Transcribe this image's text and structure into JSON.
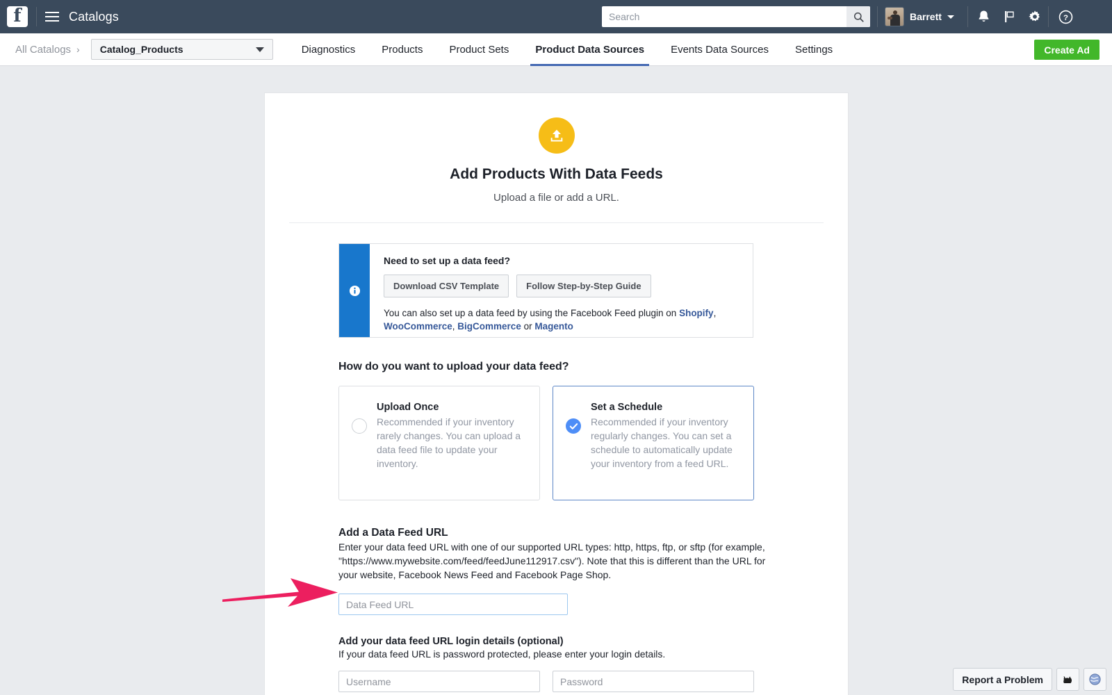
{
  "topbar": {
    "logo": "facebook-logo",
    "app_title": "Catalogs",
    "search": {
      "placeholder": "Search",
      "value": "",
      "icon": "search-icon"
    },
    "user": {
      "name": "Barrett",
      "avatar": "user-avatar"
    },
    "icons": [
      "notifications-bell-icon",
      "flag-icon",
      "gear-icon",
      "help-question-icon"
    ]
  },
  "navbar": {
    "breadcrumb": "All Catalogs",
    "breadcrumb_chevron": "›",
    "catalog_selected": "Catalog_Products",
    "tabs": [
      {
        "label": "Diagnostics",
        "active": false
      },
      {
        "label": "Products",
        "active": false
      },
      {
        "label": "Product Sets",
        "active": false
      },
      {
        "label": "Product Data Sources",
        "active": true
      },
      {
        "label": "Events Data Sources",
        "active": false
      },
      {
        "label": "Settings",
        "active": false
      }
    ],
    "create_ad_label": "Create Ad"
  },
  "card": {
    "upload_icon": "upload-arrow-icon",
    "title": "Add Products With Data Feeds",
    "subtitle": "Upload a file or add a URL.",
    "callout": {
      "icon": "info-icon",
      "heading": "Need to set up a data feed?",
      "button_csv": "Download CSV Template",
      "button_guide": "Follow Step-by-Step Guide",
      "note_prefix": "You can also set up a data feed by using the Facebook Feed plugin on ",
      "links": [
        "Shopify",
        "WooCommerce",
        "BigCommerce",
        "Magento"
      ],
      "note_sep1": ", ",
      "note_sep2": ", ",
      "note_sep3": " or "
    },
    "upload_question": "How do you want to upload your data feed?",
    "options": [
      {
        "title": "Upload Once",
        "desc": "Recommended if your inventory rarely changes. You can upload a data feed file to update your inventory.",
        "selected": false
      },
      {
        "title": "Set a Schedule",
        "desc": "Recommended if your inventory regularly changes. You can set a schedule to automatically update your inventory from a feed URL.",
        "selected": true
      }
    ],
    "feed_url": {
      "heading": "Add a Data Feed URL",
      "desc": "Enter your data feed URL with one of our supported URL types: http, https, ftp, or sftp (for example, \"https://www.mywebsite.com/feed/feedJune112917.csv\"). Note that this is different than the URL for your website, Facebook News Feed and Facebook Page Shop.",
      "placeholder": "Data Feed URL",
      "value": ""
    },
    "login": {
      "heading": "Add your data feed URL login details (optional)",
      "desc": "If your data feed URL is password protected, please enter your login details.",
      "username_placeholder": "Username",
      "username_value": "",
      "password_placeholder": "Password",
      "password_value": ""
    }
  },
  "annotation": {
    "arrow": "pink-arrow-pointing-right",
    "color": "#ec1f5f"
  },
  "bottombar": {
    "report_label": "Report a Problem",
    "icons": [
      "cat-silhouette-icon",
      "globe-icon"
    ]
  },
  "colors": {
    "topbar_bg": "#3a4a5c",
    "accent_blue": "#4267b2",
    "callout_blue": "#1877cc",
    "upload_yellow": "#f6bd17",
    "create_ad_green": "#42b72a",
    "selected_blue": "#4e8ef7",
    "arrow_pink": "#ec1f5f",
    "page_bg": "#e9ebee"
  }
}
